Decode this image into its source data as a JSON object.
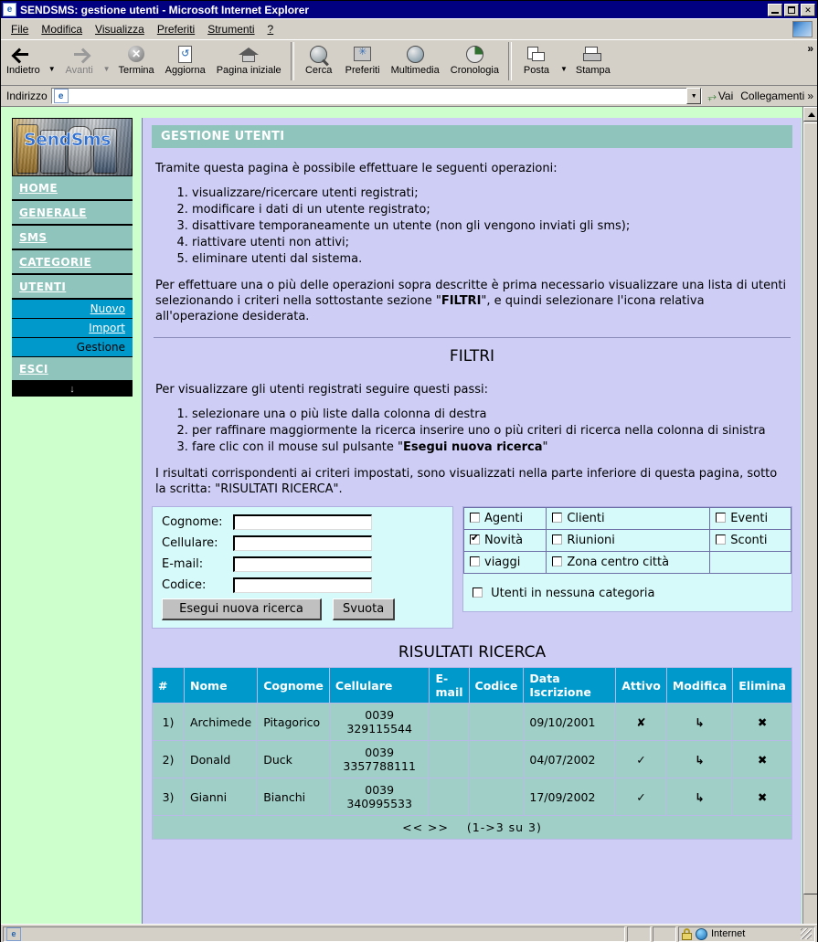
{
  "window": {
    "title": "SENDSMS: gestione utenti - Microsoft Internet Explorer",
    "icon": "ie-document-icon",
    "minimize": "_",
    "maximize": "",
    "close": "✕"
  },
  "menubar": {
    "items": [
      "File",
      "Modifica",
      "Visualizza",
      "Preferiti",
      "Strumenti",
      "?"
    ]
  },
  "toolbar": {
    "buttons": [
      {
        "label": "Indietro",
        "icon": "back-arrow-icon",
        "disabled": false
      },
      {
        "label": "Avanti",
        "icon": "forward-arrow-icon",
        "disabled": true
      },
      {
        "label": "Termina",
        "icon": "stop-icon",
        "disabled": false
      },
      {
        "label": "Aggiorna",
        "icon": "refresh-icon",
        "disabled": false
      },
      {
        "label": "Pagina iniziale",
        "icon": "home-icon",
        "disabled": false
      },
      {
        "label": "Cerca",
        "icon": "search-icon",
        "disabled": false
      },
      {
        "label": "Preferiti",
        "icon": "favorites-icon",
        "disabled": false
      },
      {
        "label": "Multimedia",
        "icon": "media-icon",
        "disabled": false
      },
      {
        "label": "Cronologia",
        "icon": "history-icon",
        "disabled": false
      },
      {
        "label": "Posta",
        "icon": "mail-icon",
        "disabled": false
      },
      {
        "label": "Stampa",
        "icon": "print-icon",
        "disabled": false
      }
    ],
    "overflow": "»"
  },
  "address": {
    "label": "Indirizzo",
    "value": "",
    "placeholder": "",
    "go_label": "Vai",
    "links_label": "Collegamenti",
    "links_overflow": "»"
  },
  "sidebar": {
    "logo_text": "SendSms",
    "menu": [
      {
        "label": "HOME",
        "type": "main"
      },
      {
        "label": "GENERALE",
        "type": "main"
      },
      {
        "label": "SMS",
        "type": "main"
      },
      {
        "label": "CATEGORIE",
        "type": "main"
      },
      {
        "label": "UTENTI",
        "type": "main"
      },
      {
        "label": "Nuovo",
        "type": "sub"
      },
      {
        "label": "Import",
        "type": "sub"
      },
      {
        "label": "Gestione",
        "type": "sub-current"
      },
      {
        "label": "ESCI",
        "type": "main"
      }
    ],
    "footer_icon": "↓"
  },
  "page": {
    "header": "GESTIONE UTENTI",
    "intro": "Tramite questa pagina è possibile effettuare le seguenti operazioni:",
    "operations": [
      "visualizzare/ricercare utenti registrati;",
      "modificare i dati di un utente registrato;",
      "disattivare temporaneamente un utente (non gli vengono inviati gli sms);",
      "riattivare utenti non attivi;",
      "eliminare utenti dal sistema."
    ],
    "note_part1": "Per effettuare una o più delle operazioni sopra descritte è prima necessario visualizzare una lista di utenti selezionando i criteri nella sottostante sezione \"",
    "note_bold": "FILTRI",
    "note_part2": "\", e quindi selezionare l'icona relativa all'operazione desiderata.",
    "filters_title": "FILTRI",
    "filters_intro": "Per visualizzare gli utenti registrati seguire questi passi:",
    "filters_steps_1": "selezionare una o più liste dalla colonna di destra",
    "filters_steps_2": "per raffinare maggiormente la ricerca inserire uno o più criteri di ricerca nella colonna di sinistra",
    "filters_steps_3_pre": "fare clic con il mouse sul pulsante \"",
    "filters_steps_3_bold": "Esegui nuova ricerca",
    "filters_steps_3_post": "\"",
    "filters_outro": "I risultati corrispondenti ai criteri impostati, sono visualizzati nella parte inferiore di questa pagina, sotto la scritta: \"RISULTATI RICERCA\"."
  },
  "search_form": {
    "fields": [
      {
        "label": "Cognome:",
        "value": "",
        "placeholder": ""
      },
      {
        "label": "Cellulare:",
        "value": "",
        "placeholder": ""
      },
      {
        "label": "E-mail:",
        "value": "",
        "placeholder": ""
      },
      {
        "label": "Codice:",
        "value": "",
        "placeholder": ""
      }
    ],
    "submit_label": "Esegui nuova ricerca",
    "clear_label": "Svuota"
  },
  "categories": {
    "rows": [
      [
        {
          "label": "Agenti",
          "checked": false
        },
        {
          "label": "Clienti",
          "checked": false
        },
        {
          "label": "Eventi",
          "checked": false
        }
      ],
      [
        {
          "label": "Novità",
          "checked": true
        },
        {
          "label": "Riunioni",
          "checked": false
        },
        {
          "label": "Sconti",
          "checked": false
        }
      ],
      [
        {
          "label": "viaggi",
          "checked": false
        },
        {
          "label": "Zona centro città",
          "checked": false
        },
        {
          "label": "",
          "checked": null
        }
      ]
    ],
    "no_category": {
      "label": "Utenti in nessuna categoria",
      "checked": false
    }
  },
  "results": {
    "title": "RISULTATI RICERCA",
    "columns": [
      "#",
      "Nome",
      "Cognome",
      "Cellulare",
      "E-mail",
      "Codice",
      "Data Iscrizione",
      "Attivo",
      "Modifica",
      "Elimina"
    ],
    "rows": [
      {
        "num": "1)",
        "nome": "Archimede",
        "cognome": "Pitagorico",
        "cellulare": "0039 329115544",
        "email": "",
        "codice": "",
        "data": "09/10/2001",
        "attivo": "✘",
        "attivo_state": "inactive",
        "modifica": "↳",
        "elimina": "✖"
      },
      {
        "num": "2)",
        "nome": "Donald",
        "cognome": "Duck",
        "cellulare": "0039 3357788111",
        "email": "",
        "codice": "",
        "data": "04/07/2002",
        "attivo": "✓",
        "attivo_state": "active",
        "modifica": "↳",
        "elimina": "✖"
      },
      {
        "num": "3)",
        "nome": "Gianni",
        "cognome": "Bianchi",
        "cellulare": "0039 340995533",
        "email": "",
        "codice": "",
        "data": "17/09/2002",
        "attivo": "✓",
        "attivo_state": "active",
        "modifica": "↳",
        "elimina": "✖"
      }
    ],
    "pager_prev": "<<",
    "pager_next": ">>",
    "pager_info": "(1->3 su 3)"
  },
  "statusbar": {
    "message": "",
    "zone": "Internet",
    "security_icon": "lock-icon",
    "zone_icon": "globe-icon"
  },
  "colors": {
    "titlebar": "#000080",
    "chrome": "#d4d0c8",
    "page_background": "#ccffcc",
    "content_background": "#cdcdf5",
    "accent_teal": "#8fc4bc",
    "accent_blue": "#0099cc",
    "panel_cyan": "#d6fafa",
    "table_row": "#9fcfc7",
    "active_green": "#00aa00",
    "inactive_red": "#cc0000"
  }
}
